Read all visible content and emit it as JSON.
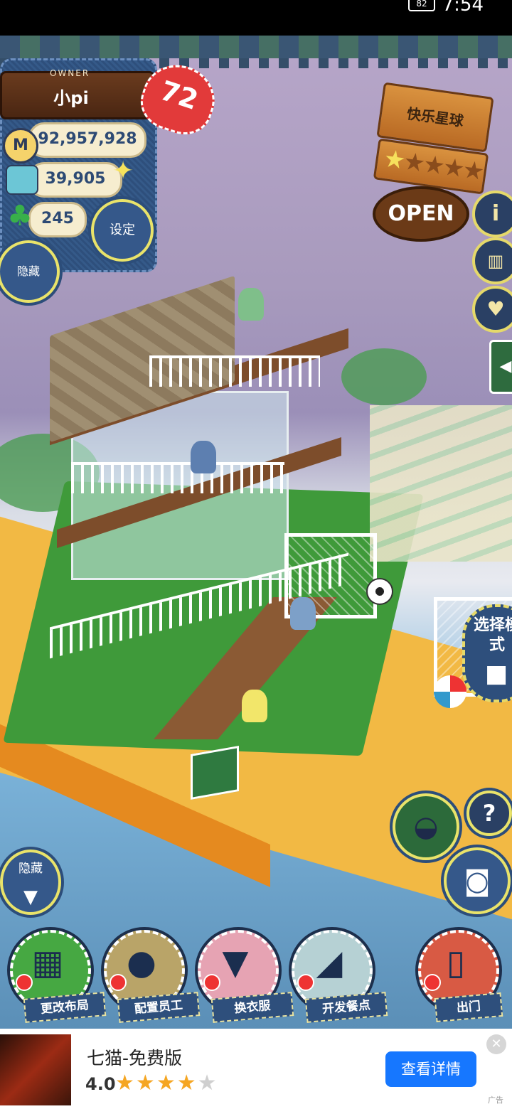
{
  "status_bar": {
    "time": "7:54",
    "battery": "82"
  },
  "owner": {
    "tag": "OWNER",
    "name": "小pi",
    "level": "72"
  },
  "currencies": {
    "coins": "92,957,928",
    "ingredients": "39,905",
    "clovers": "245"
  },
  "buttons": {
    "settings": "设定",
    "hide_top": "隐藏",
    "hide_bottom": "隐藏",
    "select_mode": "选择模式",
    "help": "?"
  },
  "shop": {
    "name": "快乐星球",
    "status": "OPEN",
    "rating_stars": 1,
    "rating_max": 5
  },
  "menu": [
    {
      "label": "更改布局",
      "icon": "table-icon",
      "color": "#46a842"
    },
    {
      "label": "配置员工",
      "icon": "bear-head-icon",
      "color": "#b9a468"
    },
    {
      "label": "换衣服",
      "icon": "tshirt-icon",
      "color": "#e6a3b3"
    },
    {
      "label": "开发餐点",
      "icon": "knife-icon",
      "color": "#b6d1d4"
    },
    {
      "label": "出门",
      "icon": "door-icon",
      "color": "#d85a44"
    }
  ],
  "ad": {
    "title": "七猫-免费版",
    "rating": "4.0",
    "stars_filled": 4,
    "stars_total": 5,
    "cta": "查看详情",
    "label": "广告"
  }
}
